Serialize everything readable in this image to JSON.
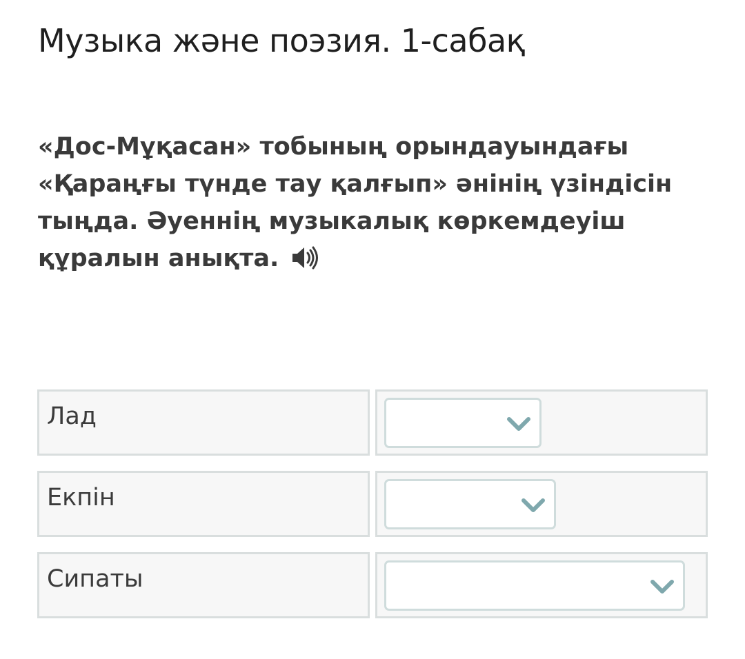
{
  "lesson": {
    "title": "Музыка және поэзия. 1-сабақ"
  },
  "question": {
    "lines": [
      "«Дос-Мұқасан» тобының орындауындағы",
      "«Қараңғы түнде тау қалғып» әнінің үзіндісін",
      "тыңда. Әуеннің музыкалық көркемдеуіш",
      "құралын анықта."
    ],
    "audio_icon": "speaker-icon"
  },
  "matching": {
    "rows": [
      {
        "label": "Лад",
        "selected": ""
      },
      {
        "label": "Екпін",
        "selected": ""
      },
      {
        "label": "Сипаты",
        "selected": ""
      }
    ]
  },
  "colors": {
    "cell_border": "#d9dede",
    "cell_background": "#f7f7f7",
    "select_border": "#cfdcdc",
    "chevron": "#7fa8ad"
  }
}
